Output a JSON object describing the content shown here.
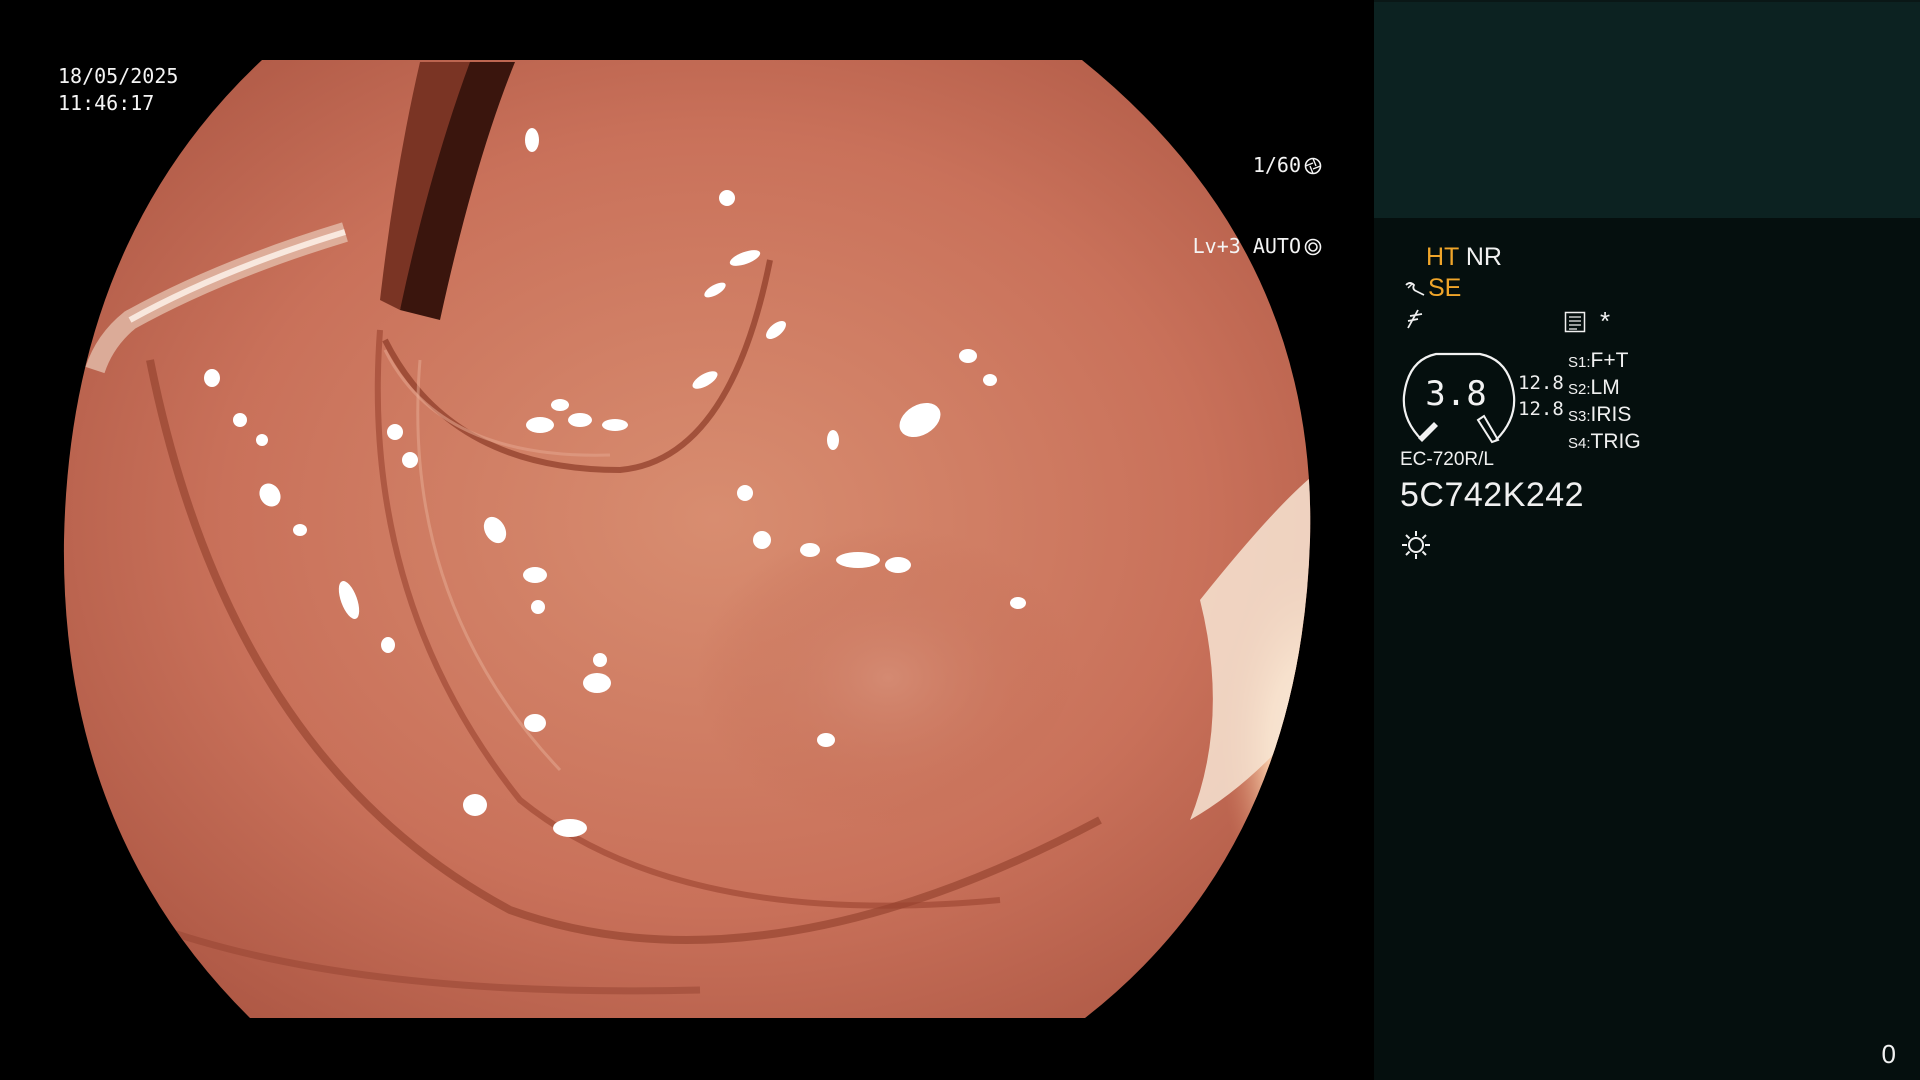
{
  "overlay": {
    "date": "18/05/2025",
    "time": "11:46:17",
    "shutter": "1/60",
    "shutter_icon": "aperture-icon",
    "exposure_mode": "Lv+3 AUTO",
    "exposure_icon": "auto-exposure-icon"
  },
  "panel": {
    "mode_ht": "HT",
    "mode_nr": "NR",
    "mode_se": "SE",
    "settings_icon": "menu-list-icon",
    "asterisk": "*",
    "gauge_value": "3.8",
    "readings": [
      "12.8",
      "12.8"
    ],
    "switches": [
      {
        "key": "S1:",
        "value": "F+T"
      },
      {
        "key": "S2:",
        "value": "LM"
      },
      {
        "key": "S3:",
        "value": "IRIS"
      },
      {
        "key": "S4:",
        "value": "TRIG"
      }
    ],
    "scope_model": "EC-720R/L",
    "serial_number": "5C742K242",
    "light_icon": "light-source-icon",
    "frame_counter": "0"
  },
  "colors": {
    "panel_bg": "#050f0e",
    "panel_top_bg": "#0c2221",
    "amber_text": "#f0a52a",
    "tissue": "#c8735a"
  }
}
